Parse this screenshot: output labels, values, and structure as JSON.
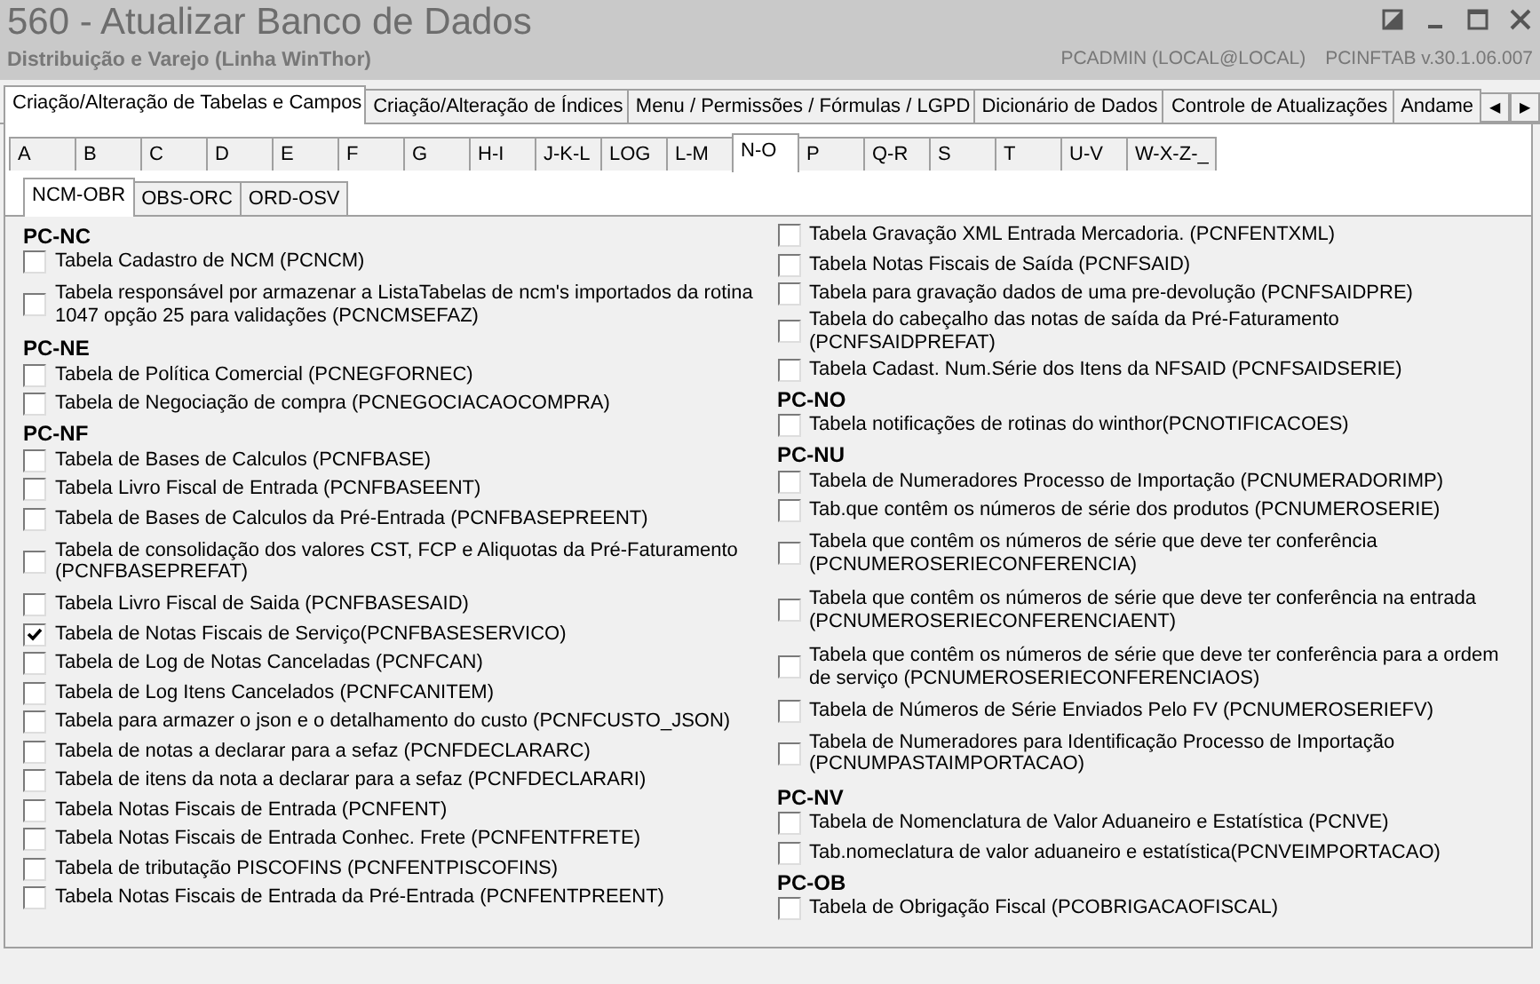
{
  "window": {
    "title": "560 - Atualizar Banco de Dados",
    "subtitle": "Distribuição e Varejo (Linha WinThor)",
    "user": "PCADMIN (LOCAL@LOCAL)",
    "module": "PCINFTAB  v.30.1.06.007"
  },
  "main_tabs": [
    {
      "label": "Criação/Alteração de Tabelas e Campos",
      "selected": true
    },
    {
      "label": "Criação/Alteração de Índices",
      "selected": false
    },
    {
      "label": "Menu / Permissões / Fórmulas / LGPD",
      "selected": false
    },
    {
      "label": "Dicionário de Dados",
      "selected": false
    },
    {
      "label": "Controle de Atualizações",
      "selected": false
    },
    {
      "label": "Andame",
      "selected": false
    }
  ],
  "tab_scroll": [
    "◀",
    "▶"
  ],
  "letter_tabs": [
    {
      "label": "A",
      "selected": false
    },
    {
      "label": "B",
      "selected": false
    },
    {
      "label": "C",
      "selected": false
    },
    {
      "label": "D",
      "selected": false
    },
    {
      "label": "E",
      "selected": false
    },
    {
      "label": "F",
      "selected": false
    },
    {
      "label": "G",
      "selected": false
    },
    {
      "label": "H-I",
      "selected": false
    },
    {
      "label": "J-K-L",
      "selected": false
    },
    {
      "label": "LOG",
      "selected": false
    },
    {
      "label": "L-M",
      "selected": false
    },
    {
      "label": "N-O",
      "selected": true
    },
    {
      "label": "P",
      "selected": false
    },
    {
      "label": "Q-R",
      "selected": false
    },
    {
      "label": "S",
      "selected": false
    },
    {
      "label": "T",
      "selected": false
    },
    {
      "label": "U-V",
      "selected": false
    },
    {
      "label": "W-X-Z-_",
      "selected": false
    }
  ],
  "sub_tabs": [
    {
      "label": "NCM-OBR",
      "selected": true
    },
    {
      "label": "OBS-ORC",
      "selected": false
    },
    {
      "label": "ORD-OSV",
      "selected": false
    }
  ],
  "columns": [
    [
      {
        "kind": "group",
        "label": "PC-NC"
      },
      {
        "kind": "check",
        "label": "Tabela Cadastro de NCM (PCNCM)",
        "checked": false
      },
      {
        "kind": "check",
        "label": "Tabela responsável por armazenar a ListaTabelas de ncm's importados da rotina 1047 opção 25 para validações (PCNCMSEFAZ)",
        "checked": false
      },
      {
        "kind": "group",
        "label": "PC-NE"
      },
      {
        "kind": "check",
        "label": "Tabela de Política Comercial (PCNEGFORNEC)",
        "checked": false
      },
      {
        "kind": "check",
        "label": "Tabela de Negociação de compra (PCNEGOCIACAOCOMPRA)",
        "checked": false
      },
      {
        "kind": "group",
        "label": "PC-NF"
      },
      {
        "kind": "check",
        "label": "Tabela de Bases de Calculos (PCNFBASE)",
        "checked": false
      },
      {
        "kind": "check",
        "label": "Tabela Livro Fiscal de Entrada (PCNFBASEENT)",
        "checked": false
      },
      {
        "kind": "check",
        "label": "Tabela de Bases de Calculos da Pré-Entrada (PCNFBASEPREENT)",
        "checked": false
      },
      {
        "kind": "check",
        "label": "Tabela de consolidação dos valores CST, FCP e Aliquotas da Pré-Faturamento (PCNFBASEPREFAT)",
        "checked": false
      },
      {
        "kind": "check",
        "label": "Tabela Livro Fiscal de Saida (PCNFBASESAID)",
        "checked": false
      },
      {
        "kind": "check",
        "label": "Tabela de Notas Fiscais de Serviço(PCNFBASESERVICO)",
        "checked": true
      },
      {
        "kind": "check",
        "label": "Tabela de Log de Notas Canceladas (PCNFCAN)",
        "checked": false
      },
      {
        "kind": "check",
        "label": "Tabela de Log Itens Cancelados (PCNFCANITEM)",
        "checked": false
      },
      {
        "kind": "check",
        "label": "Tabela para armazer o json e o detalhamento do custo (PCNFCUSTO_JSON)",
        "checked": false
      },
      {
        "kind": "check",
        "label": "Tabela de notas a declarar para a sefaz (PCNFDECLARARC)",
        "checked": false
      },
      {
        "kind": "check",
        "label": "Tabela de itens da nota a declarar para a sefaz (PCNFDECLARARI)",
        "checked": false
      },
      {
        "kind": "check",
        "label": "Tabela Notas Fiscais de Entrada (PCNFENT)",
        "checked": false
      },
      {
        "kind": "check",
        "label": "Tabela Notas Fiscais de Entrada  Conhec. Frete (PCNFENTFRETE)",
        "checked": false
      },
      {
        "kind": "check",
        "label": "Tabela de tributação PISCOFINS (PCNFENTPISCOFINS)",
        "checked": false
      },
      {
        "kind": "check",
        "label": "Tabela Notas Fiscais de Entrada da Pré-Entrada (PCNFENTPREENT)",
        "checked": false
      }
    ],
    [
      {
        "kind": "check",
        "label": "Tabela Gravação XML Entrada Mercadoria. (PCNFENTXML)",
        "checked": false
      },
      {
        "kind": "check",
        "label": "Tabela Notas Fiscais de Saída (PCNFSAID)",
        "checked": false
      },
      {
        "kind": "check",
        "label": "Tabela para gravação dados de uma pre-devolução (PCNFSAIDPRE)",
        "checked": false
      },
      {
        "kind": "check",
        "label": "Tabela do cabeçalho das notas de saída da Pré-Faturamento (PCNFSAIDPREFAT)",
        "checked": false
      },
      {
        "kind": "check",
        "label": "Tabela Cadast. Num.Série dos Itens da NFSAID (PCNFSAIDSERIE)",
        "checked": false
      },
      {
        "kind": "group",
        "label": "PC-NO"
      },
      {
        "kind": "check",
        "label": "Tabela notificações de rotinas do winthor(PCNOTIFICACOES)",
        "checked": false
      },
      {
        "kind": "group",
        "label": "PC-NU"
      },
      {
        "kind": "check",
        "label": "Tabela de Numeradores Processo de Importação (PCNUMERADORIMP)",
        "checked": false
      },
      {
        "kind": "check",
        "label": "Tab.que contêm os números de série dos produtos (PCNUMEROSERIE)",
        "checked": false
      },
      {
        "kind": "check",
        "label": "Tabela que contêm os números de série que deve ter conferência (PCNUMEROSERIECONFERENCIA)",
        "checked": false
      },
      {
        "kind": "check",
        "label": "Tabela que contêm os números de série que deve ter conferência na entrada (PCNUMEROSERIECONFERENCIAENT)",
        "checked": false
      },
      {
        "kind": "check",
        "label": "Tabela que contêm os números de série que deve ter conferência para a ordem de serviço (PCNUMEROSERIECONFERENCIAOS)",
        "checked": false
      },
      {
        "kind": "check",
        "label": "Tabela de Números de Série Enviados Pelo FV (PCNUMEROSERIEFV)",
        "checked": false
      },
      {
        "kind": "check",
        "label": "Tabela de Numeradores para Identificação Processo de Importação (PCNUMPASTAIMPORTACAO)",
        "checked": false
      },
      {
        "kind": "group",
        "label": "PC-NV"
      },
      {
        "kind": "check",
        "label": "Tabela de Nomenclatura de Valor Aduaneiro e Estatística (PCNVE)",
        "checked": false
      },
      {
        "kind": "check",
        "label": "Tab.nomeclatura de valor aduaneiro e estatística(PCNVEIMPORTACAO)",
        "checked": false
      },
      {
        "kind": "group",
        "label": "PC-OB"
      },
      {
        "kind": "check",
        "label": "Tabela de Obrigação Fiscal  (PCOBRIGACAOFISCAL)",
        "checked": false
      }
    ]
  ]
}
